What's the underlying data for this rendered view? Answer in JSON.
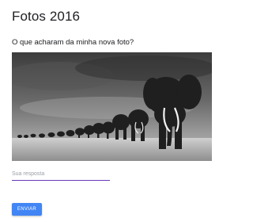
{
  "form": {
    "title": "Fotos 2016",
    "question": "O que acharam da minha nova foto?",
    "image": {
      "subject": "black-and-white photo of a herd of elephants walking in a line across a grassland under a dark cloudy sky"
    },
    "answer": {
      "value": "",
      "placeholder": "Sua resposta"
    },
    "submit_label": "ENVIAR"
  },
  "colors": {
    "submit_button": "#4285f4",
    "input_underline": "#673ab7",
    "text": "#202124",
    "placeholder": "#9aa0a6"
  }
}
